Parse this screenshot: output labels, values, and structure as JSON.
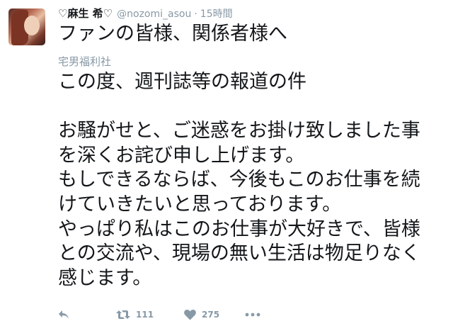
{
  "tweet": {
    "display_name": "♡麻生 希♡",
    "handle": "@nozomi_asou",
    "separator": "·",
    "time": "15時間",
    "title": "ファンの皆様、関係者様へ",
    "subtitle": "宅男福利社",
    "body_lines": [
      "この度、週刊誌等の報道の件",
      "",
      "お騒がせと、ご迷惑をお掛け致しました事",
      "を深くお詫び申し上げます。",
      "もしできるならば、今後もこのお仕事を続",
      "けていきたいと思っております。",
      "やっぱり私はこのお仕事が大好きで、皆様",
      "との交流や、現場の無い生活は物足りなく",
      "感じます。"
    ],
    "retweet_count": "111",
    "like_count": "275"
  },
  "icons": {
    "avatar": "user-avatar",
    "reply": "reply-icon",
    "retweet": "retweet-icon",
    "like": "heart-icon",
    "more": "more-icon"
  },
  "colors": {
    "text": "#14171a",
    "muted": "#8899a6",
    "background": "#ffffff"
  }
}
